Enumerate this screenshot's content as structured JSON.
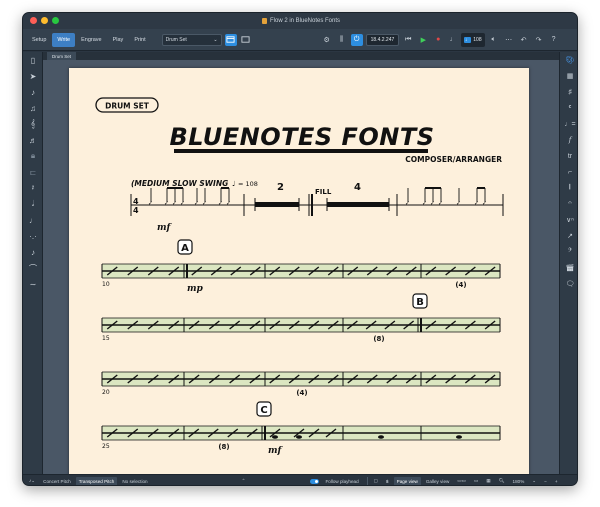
{
  "window": {
    "title": "Flow 2 in BlueNotes Fonts",
    "traffic_colors": [
      "#fe5f57",
      "#febc2e",
      "#28c840"
    ]
  },
  "toolbar": {
    "modes": [
      "Setup",
      "Write",
      "Engrave",
      "Play",
      "Print"
    ],
    "active_mode": "Write",
    "layout_select": "Drum Set",
    "counter": "18.4.2.247",
    "tempo": "108",
    "accent": "#2d8ee0"
  },
  "tab": {
    "label": "Drum Set"
  },
  "score": {
    "instrument_label": "DRUM SET",
    "title": "BLUENOTES FONTS",
    "composer": "COMPOSER/ARRANGER",
    "tempo_text": "(MEDIUM SLOW SWING",
    "tempo_value": "= 108",
    "time_sig_top": "4",
    "time_sig_bottom": "4",
    "dynamic_mf": "mf",
    "dynamic_mp": "mp",
    "multirest_count": "2",
    "fill_label": "FILL",
    "fill_count": "4",
    "rehearsal_marks": [
      "A",
      "B",
      "C"
    ],
    "bar_numbers": [
      "10",
      "15",
      "20",
      "25"
    ],
    "count_4": "(4)",
    "count_8": "(8)"
  },
  "statusbar": {
    "concert_pitch": "Concert Pitch",
    "transposed_pitch": "Transposed Pitch",
    "selection": "No selection",
    "follow_playhead": "Follow playhead",
    "page_view": "Page view",
    "galley_view": "Galley view",
    "zoom": "180%"
  }
}
